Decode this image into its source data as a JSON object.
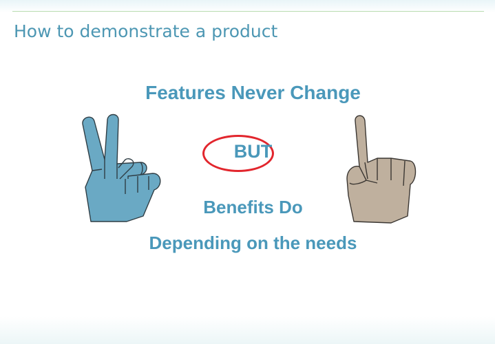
{
  "slide": {
    "title": "How to demonstrate a product",
    "line_features": "Features Never Change",
    "line_but": "BUT",
    "line_benefits": "Benefits Do",
    "line_depending": "Depending on the needs"
  },
  "colors": {
    "title": "#4d97b3",
    "body_text": "#4a98ba",
    "but_circle": "#e2262d",
    "left_hand": "#6aa9c4",
    "right_hand": "#bfb09e"
  },
  "icons": {
    "left_hand": "two-fingers-hand-icon",
    "right_hand": "one-finger-hand-icon"
  }
}
